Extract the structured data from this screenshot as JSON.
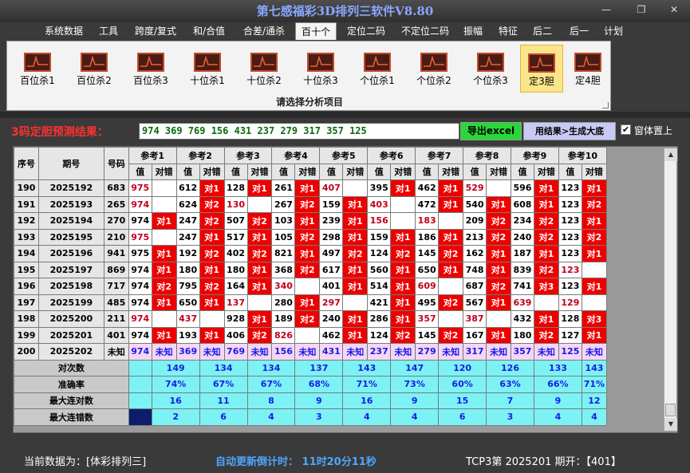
{
  "window": {
    "title": "第七感福彩3D排列三软件V8.80",
    "min": "—",
    "max": "❐",
    "close": "✕"
  },
  "menu": [
    "系统数据",
    "工具",
    "跨度/复式",
    "和/合值",
    "合差/通杀",
    "百十个",
    "定位二码",
    "不定位二码",
    "振幅",
    "特征",
    "后二",
    "后一",
    "计划"
  ],
  "active_menu": "百十个",
  "ribbon": {
    "buttons": [
      "百位杀1",
      "百位杀2",
      "百位杀3",
      "十位杀1",
      "十位杀2",
      "十位杀3",
      "个位杀1",
      "个位杀2",
      "个位杀3",
      "定3胆",
      "定4胆"
    ],
    "active_button": "定3胆",
    "caption": "请选择分析项目"
  },
  "result": {
    "label": "3码定胆预测结果：",
    "value": "974 369 769 156 431 237 279 317 357 125",
    "export_button": "导出excel",
    "generate_button": "用结果>生成大底",
    "checkbox_label": "窗体置上",
    "checkbox_checked": "✔"
  },
  "table": {
    "header_left": [
      "序号",
      "期号",
      "号码"
    ],
    "ref_groups": [
      "参考1",
      "参考2",
      "参考3",
      "参考4",
      "参考5",
      "参考6",
      "参考7",
      "参考8",
      "参考9",
      "参考10"
    ],
    "sub_headers": [
      "值",
      "对错"
    ],
    "rows": [
      {
        "seq": "190",
        "period": "2025192",
        "num": "683",
        "vals": [
          "975",
          "612",
          "128",
          "261",
          "407",
          "395",
          "462",
          "529",
          "596",
          "123"
        ],
        "red": [
          1,
          0,
          0,
          0,
          1,
          0,
          0,
          1,
          0,
          0
        ],
        "marks": [
          "",
          "对1",
          "对1",
          "对1",
          "",
          "对1",
          "对1",
          "",
          "对1",
          "对1"
        ]
      },
      {
        "seq": "191",
        "period": "2025193",
        "num": "265",
        "vals": [
          "974",
          "624",
          "130",
          "267",
          "159",
          "403",
          "472",
          "540",
          "608",
          "123"
        ],
        "red": [
          1,
          0,
          1,
          0,
          0,
          1,
          0,
          0,
          0,
          0
        ],
        "marks": [
          "",
          "对2",
          "",
          "对2",
          "对1",
          "",
          "对1",
          "对1",
          "对1",
          "对2"
        ]
      },
      {
        "seq": "192",
        "period": "2025194",
        "num": "270",
        "vals": [
          "974",
          "247",
          "507",
          "103",
          "239",
          "156",
          "183",
          "209",
          "234",
          "123"
        ],
        "red": [
          0,
          0,
          0,
          0,
          0,
          1,
          1,
          0,
          0,
          0
        ],
        "marks": [
          "对1",
          "对2",
          "对2",
          "对1",
          "对1",
          "",
          "",
          "对2",
          "对2",
          "对1"
        ]
      },
      {
        "seq": "193",
        "period": "2025195",
        "num": "210",
        "vals": [
          "975",
          "247",
          "517",
          "105",
          "298",
          "159",
          "186",
          "213",
          "240",
          "123"
        ],
        "red": [
          1,
          0,
          0,
          0,
          0,
          0,
          0,
          0,
          0,
          0
        ],
        "marks": [
          "",
          "对1",
          "对1",
          "对2",
          "对1",
          "对1",
          "对1",
          "对2",
          "对2",
          "对2"
        ]
      },
      {
        "seq": "194",
        "period": "2025196",
        "num": "941",
        "vals": [
          "975",
          "192",
          "402",
          "821",
          "497",
          "124",
          "145",
          "162",
          "187",
          "123"
        ],
        "red": [
          0,
          0,
          0,
          0,
          0,
          0,
          0,
          0,
          0,
          0
        ],
        "marks": [
          "对1",
          "对2",
          "对2",
          "对1",
          "对2",
          "对2",
          "对2",
          "对1",
          "对1",
          "对1"
        ]
      },
      {
        "seq": "195",
        "period": "2025197",
        "num": "869",
        "vals": [
          "974",
          "180",
          "180",
          "368",
          "617",
          "560",
          "650",
          "748",
          "839",
          "123"
        ],
        "red": [
          0,
          0,
          0,
          0,
          0,
          0,
          0,
          0,
          0,
          1
        ],
        "marks": [
          "对1",
          "对1",
          "对1",
          "对2",
          "对1",
          "对1",
          "对1",
          "对1",
          "对2",
          ""
        ]
      },
      {
        "seq": "196",
        "period": "2025198",
        "num": "717",
        "vals": [
          "974",
          "795",
          "164",
          "340",
          "401",
          "514",
          "609",
          "687",
          "741",
          "123"
        ],
        "red": [
          0,
          0,
          0,
          1,
          0,
          0,
          1,
          0,
          0,
          0
        ],
        "marks": [
          "对2",
          "对2",
          "对1",
          "",
          "对1",
          "对1",
          "",
          "对2",
          "对3",
          "对1"
        ]
      },
      {
        "seq": "197",
        "period": "2025199",
        "num": "485",
        "vals": [
          "974",
          "650",
          "137",
          "280",
          "297",
          "421",
          "495",
          "567",
          "639",
          "129"
        ],
        "red": [
          0,
          0,
          1,
          0,
          1,
          0,
          0,
          0,
          1,
          1
        ],
        "marks": [
          "对1",
          "对1",
          "",
          "对1",
          "",
          "对1",
          "对2",
          "对1",
          "",
          ""
        ]
      },
      {
        "seq": "198",
        "period": "2025200",
        "num": "211",
        "vals": [
          "974",
          "437",
          "928",
          "189",
          "240",
          "286",
          "357",
          "387",
          "432",
          "128"
        ],
        "red": [
          1,
          1,
          0,
          0,
          0,
          0,
          1,
          1,
          0,
          0
        ],
        "marks": [
          "",
          "",
          "对1",
          "对2",
          "对1",
          "对1",
          "",
          "",
          "对1",
          "对3"
        ]
      },
      {
        "seq": "199",
        "period": "2025201",
        "num": "401",
        "vals": [
          "974",
          "193",
          "406",
          "826",
          "462",
          "124",
          "145",
          "167",
          "180",
          "127"
        ],
        "red": [
          0,
          0,
          0,
          1,
          0,
          0,
          0,
          0,
          0,
          0
        ],
        "marks": [
          "对1",
          "对1",
          "对2",
          "",
          "对1",
          "对2",
          "对2",
          "对1",
          "对2",
          "对1"
        ]
      }
    ],
    "predict_row": {
      "seq": "200",
      "period": "2025202",
      "num": "未知",
      "vals": [
        "974",
        "369",
        "769",
        "156",
        "431",
        "237",
        "279",
        "317",
        "357",
        "125"
      ],
      "mark": "未知"
    },
    "stats": [
      {
        "label": "对次数",
        "values": [
          "149",
          "134",
          "134",
          "137",
          "143",
          "147",
          "120",
          "126",
          "133",
          "143"
        ]
      },
      {
        "label": "准确率",
        "values": [
          "74%",
          "67%",
          "67%",
          "68%",
          "71%",
          "73%",
          "60%",
          "63%",
          "66%",
          "71%"
        ]
      },
      {
        "label": "最大连对数",
        "values": [
          "16",
          "11",
          "8",
          "9",
          "16",
          "9",
          "15",
          "7",
          "9",
          "12"
        ]
      },
      {
        "label": "最大连错数",
        "values": [
          "2",
          "6",
          "4",
          "3",
          "4",
          "4",
          "6",
          "3",
          "4",
          "4"
        ]
      }
    ]
  },
  "status": {
    "current_data": "当前数据为：[体彩排列三]",
    "countdown": "自动更新倒计时：  11时20分11秒",
    "latest": "TCP3第 2025201 期开：【401】"
  },
  "colors": {
    "hit": "#ee0000",
    "stats_bg": "#7df2f5",
    "predict_bg": "#f5d7f5",
    "title": "#8aa7ff"
  }
}
